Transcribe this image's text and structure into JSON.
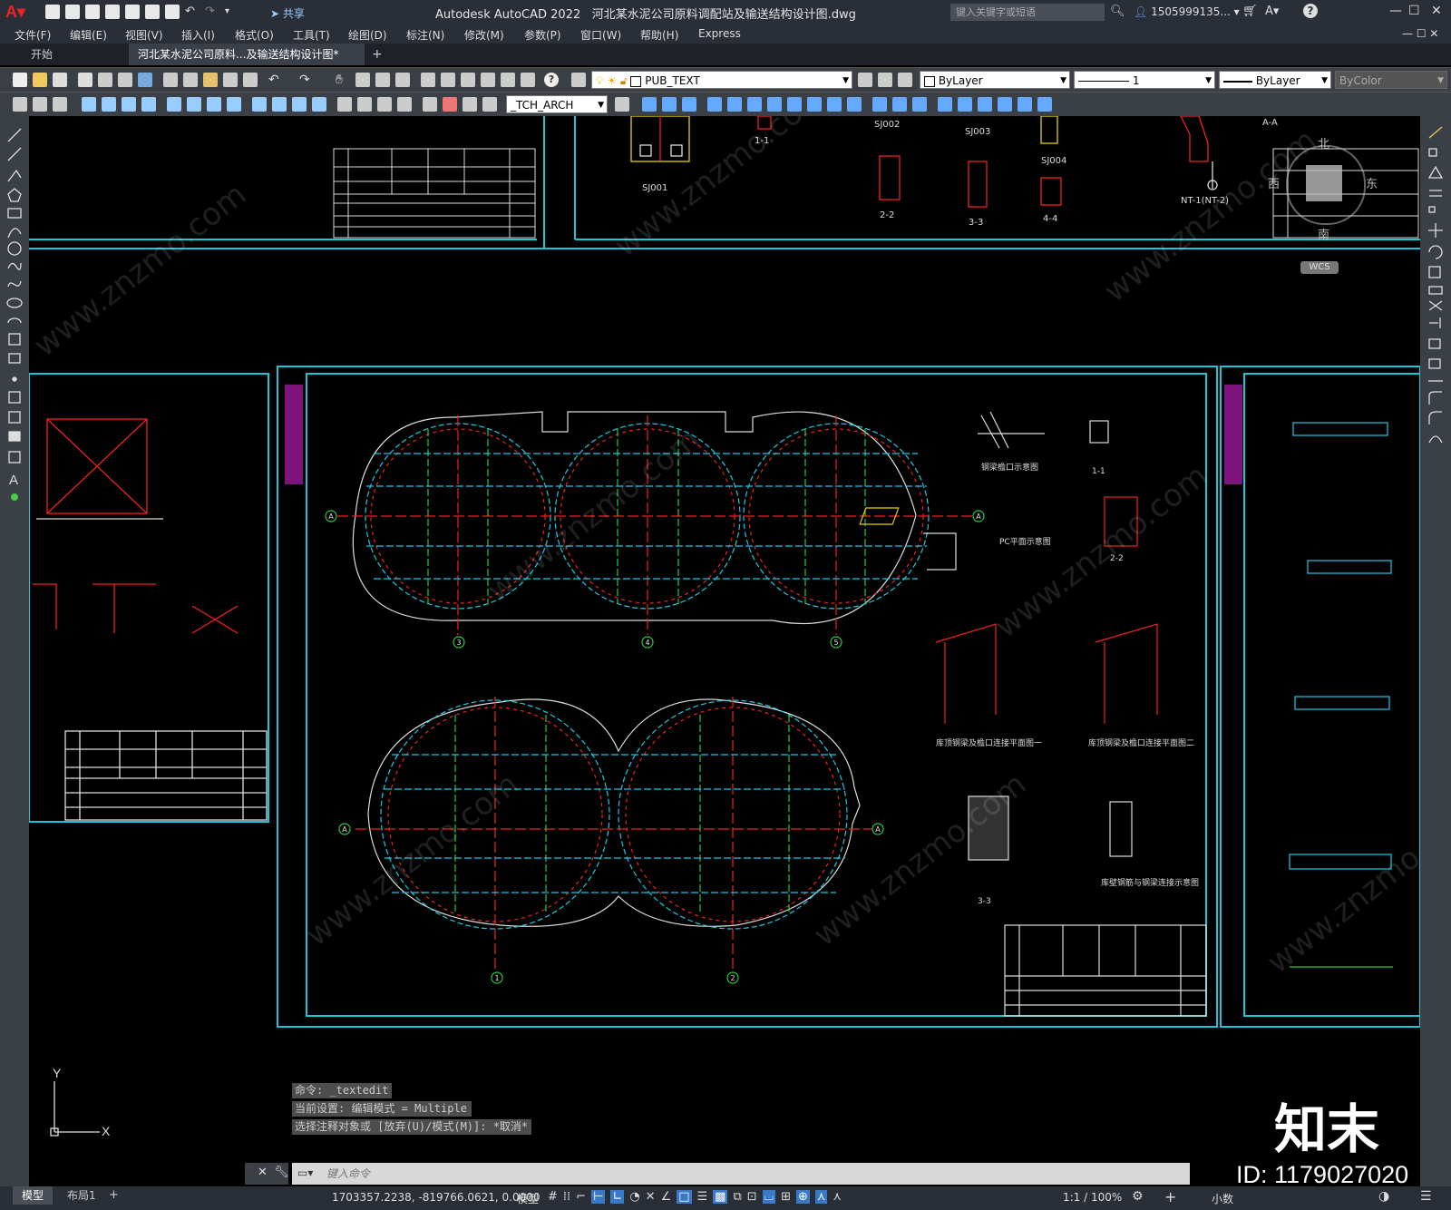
{
  "title_bar": {
    "app_title": "Autodesk AutoCAD 2022",
    "file_title": "河北某水泥公司原料调配站及输送结构设计图.dwg",
    "share_label": "共享",
    "search_placeholder": "键入关键字或短语",
    "user_name": "1505999135...",
    "minimize": "—",
    "restore": "☐",
    "close": "✕"
  },
  "menu": {
    "items": [
      "文件(F)",
      "编辑(E)",
      "视图(V)",
      "插入(I)",
      "格式(O)",
      "工具(T)",
      "绘图(D)",
      "标注(N)",
      "修改(M)",
      "参数(P)",
      "窗口(W)",
      "帮助(H)",
      "Express"
    ]
  },
  "tabs": {
    "start": "开始",
    "drawing": "河北某水泥公司原料...及输送结构设计图*",
    "close_icon": "✕",
    "add_icon": "+"
  },
  "toolbar1": {
    "layer_combo": "PUB_TEXT",
    "color_combo": "ByLayer",
    "linetype_value": "1",
    "lineweight_combo": "ByLayer",
    "plotstyle_combo": "ByColor"
  },
  "toolbar2": {
    "textstyle_combo": "_TCH_ARCH"
  },
  "viewcube": {
    "north": "北",
    "west": "西",
    "east": "东",
    "south": "南",
    "wcs": "WCS"
  },
  "drawing_labels": {
    "sj001": "SJ001",
    "sj002": "SJ002",
    "sj003": "SJ003",
    "sj004": "SJ004",
    "section_11": "1-1",
    "section_22": "2-2",
    "section_33": "3-3",
    "section_44": "4-4",
    "aa": "A-A",
    "nt": "NT-1(NT-2)",
    "grid_a": "A",
    "grid_3": "3",
    "grid_4": "4",
    "grid_5": "5",
    "grid_1": "1",
    "grid_2": "2",
    "pc_plan": "PC平面示意图",
    "detail_11": "1-1",
    "detail_22": "2-2",
    "detail_33": "3-3",
    "steel_conn_1": "库顶钢梁及檐口连接平面图一",
    "steel_conn_2": "库顶钢梁及檐口连接平面图二",
    "steel_detail": "钢梁檐口示意图",
    "conn_detail": "库壁钢筋与钢梁连接示意图"
  },
  "command": {
    "history": [
      "命令: _textedit",
      "当前设置: 编辑模式 = Multiple",
      "选择注释对象或 [放弃(U)/模式(M)]: *取消*"
    ],
    "input_placeholder": "键入命令"
  },
  "status": {
    "model_tab": "模型",
    "layout_tab": "布局1",
    "add_tab": "+",
    "coords": "1703357.2238, -819766.0621, 0.0000",
    "space": "模型",
    "scale": "1:1 / 100%",
    "units": "小数"
  },
  "watermark": {
    "site": "www.znzmo.com",
    "brand": "知末",
    "id": "ID: 1179027020"
  },
  "colors": {
    "frame": "#19c8d8",
    "accent_red": "#e22222",
    "grid_green": "#22cc44",
    "dim_cyan": "#1ec8e6"
  }
}
